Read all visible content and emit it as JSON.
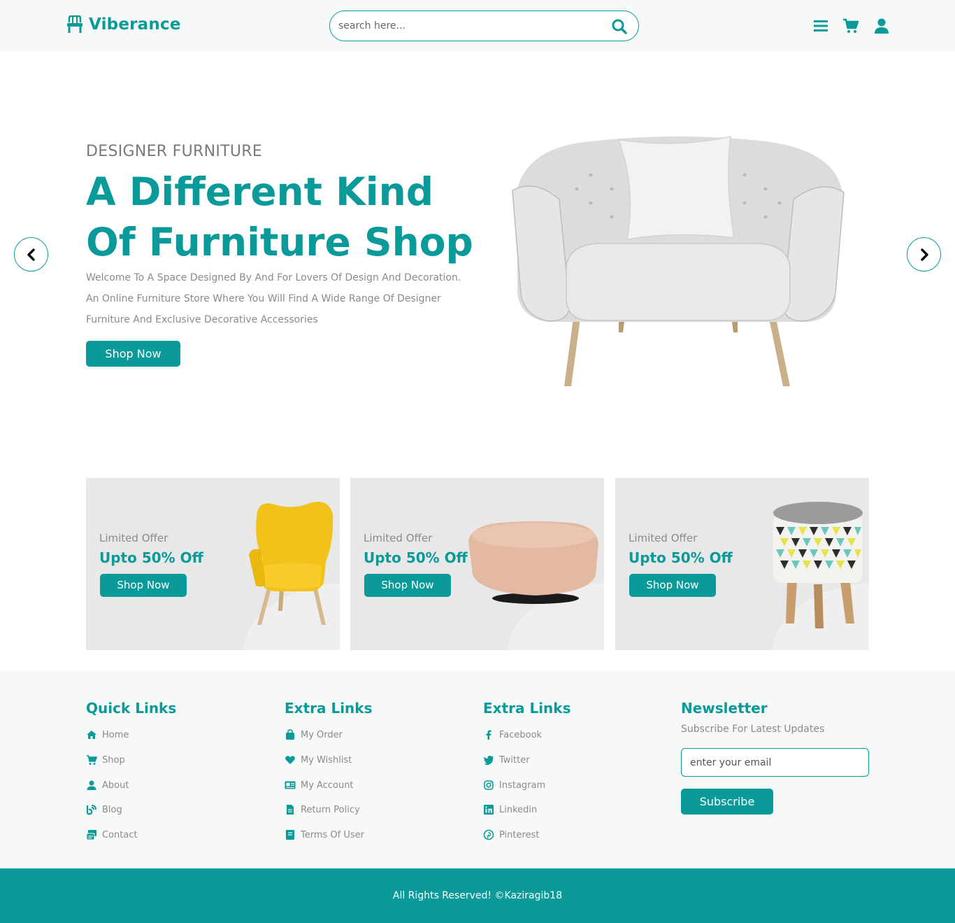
{
  "brand": {
    "name": "Viberance",
    "icon": "chair-icon"
  },
  "search": {
    "placeholder": "search here...",
    "icon": "search-icon"
  },
  "header_icons": [
    "menu-icon",
    "cart-icon",
    "user-icon"
  ],
  "hero": {
    "subtitle": "DESIGNER FURNITURE",
    "title": "A Different Kind Of Furniture Shop",
    "description": "Welcome To A Space Designed By And For Lovers Of Design And Decoration. An Online Furniture Store Where You Will Find A Wide Range Of Designer Furniture And Exclusive Decorative Accessories",
    "button": "Shop Now",
    "prev_icon": "chevron-left-icon",
    "next_icon": "chevron-right-icon"
  },
  "offers": [
    {
      "label": "Limited Offer",
      "title": "Upto 50% Off",
      "button": "Shop Now",
      "image": "yellow-armchair"
    },
    {
      "label": "Limited Offer",
      "title": "Upto 50% Off",
      "button": "Shop Now",
      "image": "pink-ottoman"
    },
    {
      "label": "Limited Offer",
      "title": "Upto 50% Off",
      "button": "Shop Now",
      "image": "patterned-stool"
    }
  ],
  "footer": {
    "quick_links": {
      "title": "Quick Links",
      "items": [
        {
          "label": "Home",
          "icon": "home-icon"
        },
        {
          "label": "Shop",
          "icon": "cart-icon"
        },
        {
          "label": "About",
          "icon": "user-icon"
        },
        {
          "label": "Blog",
          "icon": "blog-icon"
        },
        {
          "label": "Contact",
          "icon": "contact-icon"
        }
      ]
    },
    "extra_links": {
      "title": "Extra Links",
      "items": [
        {
          "label": "My Order",
          "icon": "bag-icon"
        },
        {
          "label": "My Wishlist",
          "icon": "heart-icon"
        },
        {
          "label": "My Account",
          "icon": "id-card-icon"
        },
        {
          "label": "Return Policy",
          "icon": "document-icon"
        },
        {
          "label": "Terms Of User",
          "icon": "book-icon"
        }
      ]
    },
    "social_links": {
      "title": "Extra Links",
      "items": [
        {
          "label": "Facebook",
          "icon": "facebook-icon"
        },
        {
          "label": "Twitter",
          "icon": "twitter-icon"
        },
        {
          "label": "Instagram",
          "icon": "instagram-icon"
        },
        {
          "label": "Linkedin",
          "icon": "linkedin-icon"
        },
        {
          "label": "Pinterest",
          "icon": "pinterest-icon"
        }
      ]
    },
    "newsletter": {
      "title": "Newsletter",
      "subtitle": "Subscribe For Latest Updates",
      "placeholder": "enter your email",
      "button": "Subscribe"
    }
  },
  "copyright": "All Rights Reserved! ©Kaziragib18",
  "colors": {
    "accent": "#0a9a9a",
    "header_bg": "#f6f9f7",
    "card_bg": "#e8e8e8"
  }
}
